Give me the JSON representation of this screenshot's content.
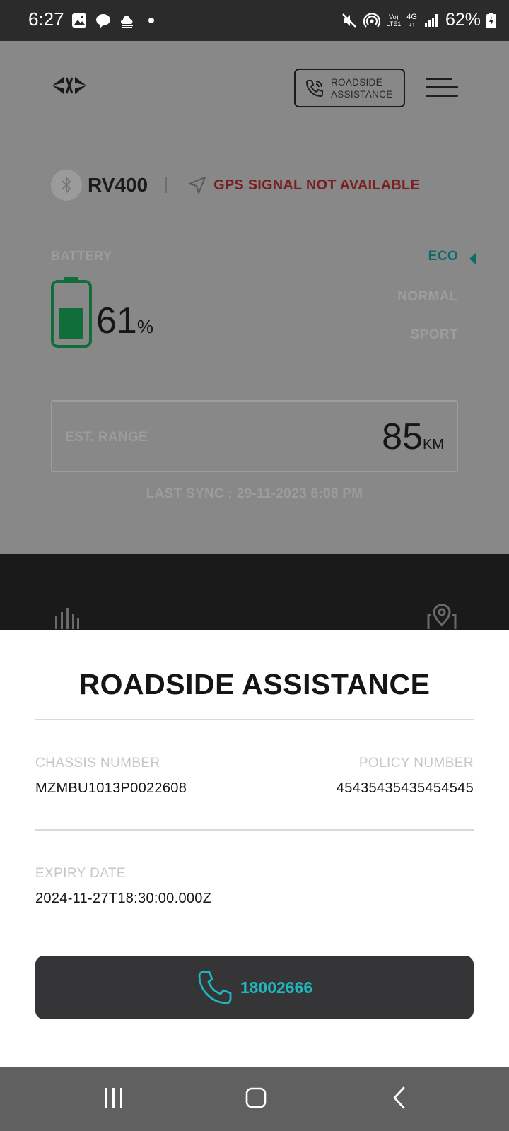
{
  "status_bar": {
    "time": "6:27",
    "network_top": "Vo)",
    "network_bottom": "LTE1",
    "network_type": "4G",
    "battery_percent": "62%",
    "icons": [
      "gallery-icon",
      "chat-icon",
      "cloud-icon",
      "dot-icon",
      "mute-icon",
      "hotspot-icon",
      "signal-icon",
      "battery-charging-icon"
    ]
  },
  "header": {
    "roadside_line1": "ROADSIDE",
    "roadside_line2": "ASSISTANCE"
  },
  "vehicle": {
    "name": "RV400",
    "gps_status": "GPS SIGNAL NOT AVAILABLE"
  },
  "battery": {
    "label": "BATTERY",
    "value": "61",
    "unit": "%",
    "level": 0.61
  },
  "modes": {
    "items": [
      "ECO",
      "NORMAL",
      "SPORT"
    ],
    "selected": "ECO"
  },
  "range": {
    "label": "EST. RANGE",
    "value": "85",
    "unit": "KM"
  },
  "last_sync": "LAST SYNC : 29-11-2023 6:08 PM",
  "colors": {
    "accent_teal": "#1fb7bd",
    "eco_teal": "#0c6b6c",
    "battery_green": "#0f6e3a",
    "gps_red": "#7a1f1f"
  },
  "sheet": {
    "title": "ROADSIDE ASSISTANCE",
    "chassis_label": "CHASSIS NUMBER",
    "chassis_value": "MZMBU1013P0022608",
    "policy_label": "POLICY NUMBER",
    "policy_value": "45435435435454545",
    "expiry_label": "EXPIRY DATE",
    "expiry_value": "2024-11-27T18:30:00.000Z",
    "phone": "18002666"
  }
}
